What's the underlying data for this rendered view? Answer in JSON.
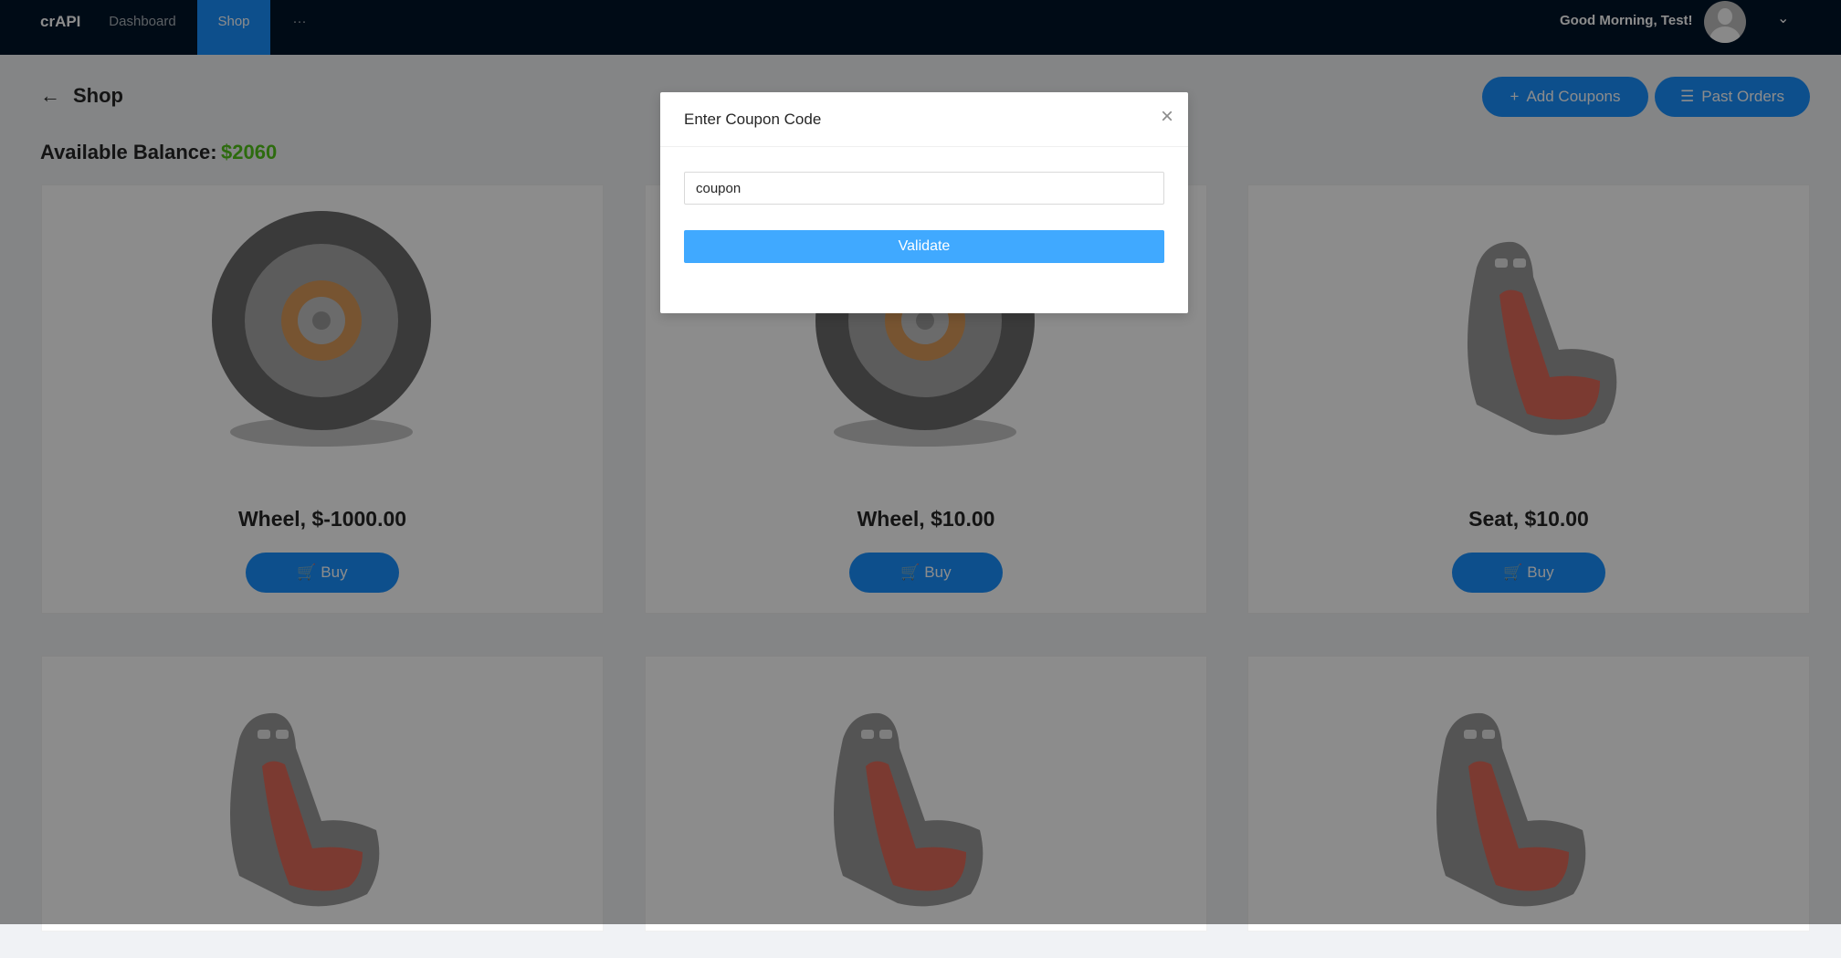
{
  "nav": {
    "brand": "crAPI",
    "items": [
      {
        "label": "Dashboard"
      },
      {
        "label": "Shop"
      }
    ],
    "more": "···",
    "greeting": "Good Morning, Test!",
    "chevron": "⌄"
  },
  "page": {
    "title": "Shop",
    "back_icon": "←",
    "add_coupons_label": "Add Coupons",
    "past_orders_label": "Past Orders",
    "balance_label": "Available Balance:",
    "balance_value": "$2060"
  },
  "products": [
    {
      "name": "Wheel, $-1000.00",
      "buy_label": "Buy",
      "image": "wheel"
    },
    {
      "name": "Wheel, $10.00",
      "buy_label": "Buy",
      "image": "wheel"
    },
    {
      "name": "Seat, $10.00",
      "buy_label": "Buy",
      "image": "seat"
    },
    {
      "image": "seat"
    },
    {
      "image": "seat"
    },
    {
      "image": "seat"
    }
  ],
  "modal": {
    "title": "Enter Coupon Code",
    "close_icon": "×",
    "input_value": "coupon",
    "validate_label": "Validate"
  },
  "colors": {
    "primary": "#1890ff",
    "nav_bg": "#001529",
    "balance": "#52c41a",
    "validate": "#40a9ff"
  }
}
